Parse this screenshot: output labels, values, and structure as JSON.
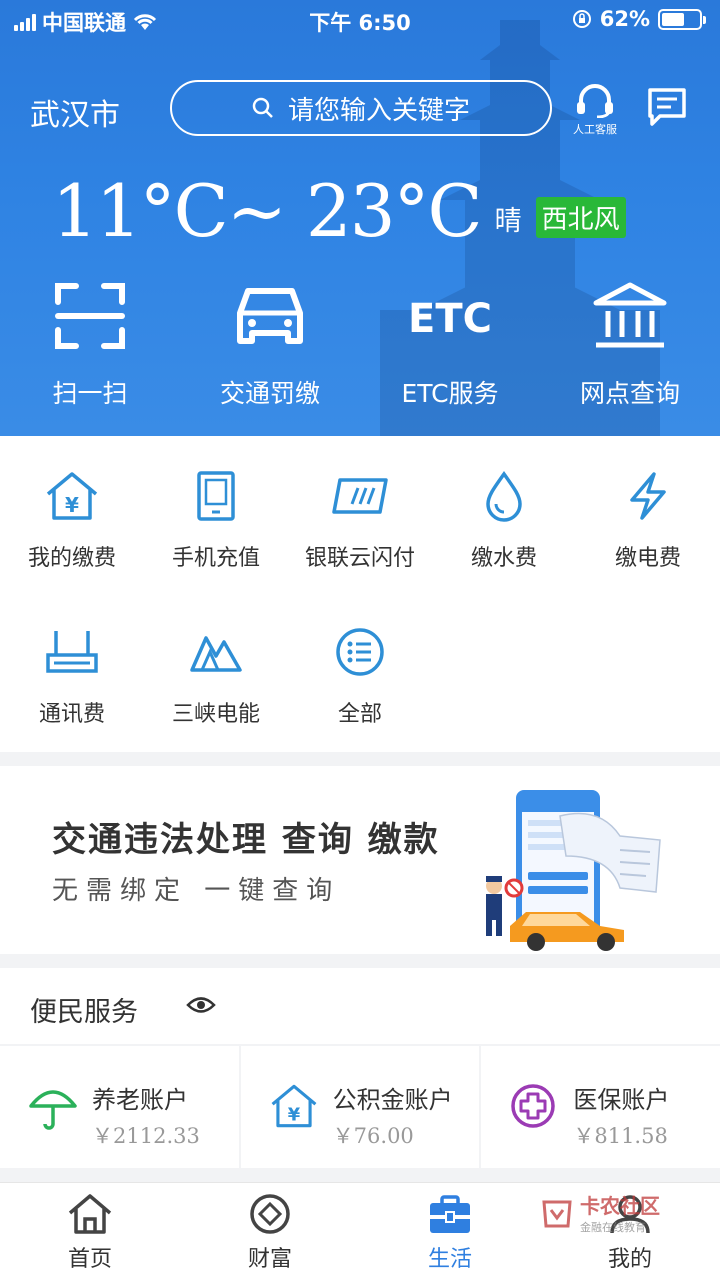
{
  "status_bar": {
    "carrier": "中国联通",
    "time": "下午 6:50",
    "battery": "62%",
    "battery_level": 0.62
  },
  "header": {
    "city": "武汉市",
    "search_placeholder": "请您输入关键字",
    "service_label": "人工客服"
  },
  "weather": {
    "temperature": "11°C~ 23°C",
    "condition": "晴",
    "wind": "西北风"
  },
  "quick_actions": [
    {
      "label": "扫一扫",
      "icon": "scan-icon"
    },
    {
      "label": "交通罚缴",
      "icon": "car-icon"
    },
    {
      "label": "ETC服务",
      "icon": "etc-icon"
    },
    {
      "label": "网点查询",
      "icon": "bank-icon"
    }
  ],
  "services": [
    {
      "label": "我的缴费",
      "icon": "house-yuan-icon"
    },
    {
      "label": "手机充值",
      "icon": "phone-icon"
    },
    {
      "label": "银联云闪付",
      "icon": "card-icon"
    },
    {
      "label": "缴水费",
      "icon": "water-drop-icon"
    },
    {
      "label": "缴电费",
      "icon": "lightning-icon"
    },
    {
      "label": "通讯费",
      "icon": "router-icon"
    },
    {
      "label": "三峡电能",
      "icon": "mountain-icon"
    },
    {
      "label": "全部",
      "icon": "list-icon"
    }
  ],
  "banner": {
    "title": "交通违法处理 查询 缴款",
    "subtitle": "无需绑定  一键查询"
  },
  "convenience": {
    "title": "便民服务",
    "accounts": [
      {
        "name": "养老账户",
        "value": "￥2112.33",
        "icon": "umbrella-icon"
      },
      {
        "name": "公积金账户",
        "value": "￥76.00",
        "icon": "house-yuan-icon"
      },
      {
        "name": "医保账户",
        "value": "￥811.58",
        "icon": "medical-cross-icon"
      }
    ]
  },
  "tabbar": [
    {
      "label": "首页",
      "icon": "home-icon"
    },
    {
      "label": "财富",
      "icon": "wealth-icon"
    },
    {
      "label": "生活",
      "icon": "briefcase-icon",
      "active": true
    },
    {
      "label": "我的",
      "icon": "user-icon"
    }
  ],
  "watermark": {
    "name": "卡农社区",
    "slogan": "金融在线教育"
  },
  "colors": {
    "primary": "#2f7fe0",
    "wind_badge": "#29b838",
    "icon_blue": "#2e8fd6"
  }
}
